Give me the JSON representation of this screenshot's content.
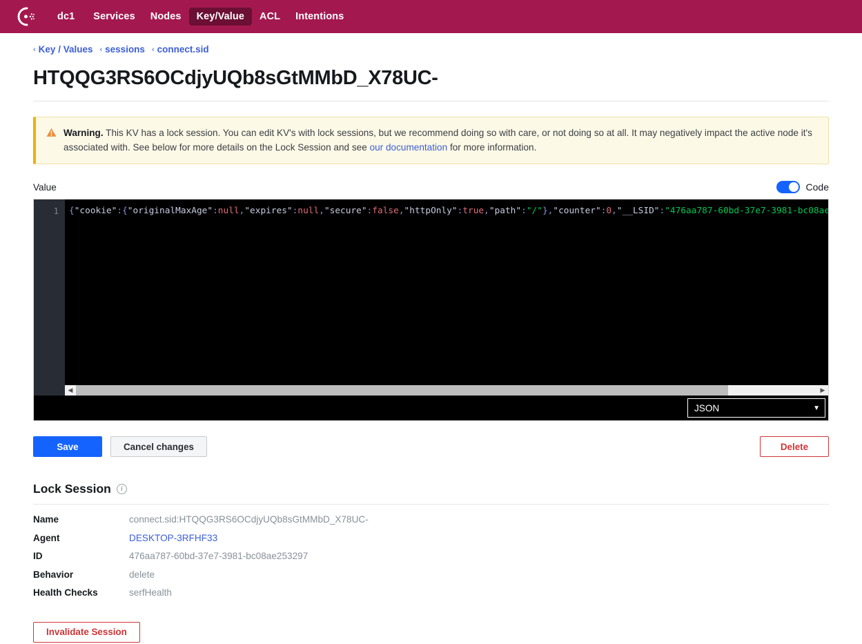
{
  "nav": {
    "logo_icon": "consul-logo-icon",
    "items": [
      {
        "label": "dc1",
        "active": false
      },
      {
        "label": "Services",
        "active": false
      },
      {
        "label": "Nodes",
        "active": false
      },
      {
        "label": "Key/Value",
        "active": true
      },
      {
        "label": "ACL",
        "active": false
      },
      {
        "label": "Intentions",
        "active": false
      }
    ]
  },
  "breadcrumb": {
    "caret": "‹",
    "items": [
      "Key / Values",
      "sessions",
      "connect.sid"
    ]
  },
  "page": {
    "title": "HTQQG3RS6OCdjyUQb8sGtMMbD_X78UC-"
  },
  "warning": {
    "icon": "warning-triangle-icon",
    "bold": "Warning.",
    "text_before_link": " This KV has a lock session. You can edit KV's with lock sessions, but we recommend doing so with care, or not doing so at all. It may negatively impact the active node it's associated with. See below for more details on the Lock Session and see ",
    "link": "our documentation",
    "text_after_link": " for more information."
  },
  "value_section": {
    "label": "Value",
    "code_toggle_label": "Code",
    "code_toggle_on": true,
    "accent_blue": "#1563ff",
    "line_number": "1",
    "language": "JSON",
    "raw_value": "{\"cookie\":{\"originalMaxAge\":null,\"expires\":null,\"secure\":false,\"httpOnly\":true,\"path\":\"/\"},\"counter\":0,\"__LSID\":\"476aa787-60bd-37e7-3981-bc08ae",
    "tokens": [
      {
        "t": "{",
        "c": "punct"
      },
      {
        "t": "\"cookie\"",
        "c": "key"
      },
      {
        "t": ":{",
        "c": "punct"
      },
      {
        "t": "\"originalMaxAge\"",
        "c": "key"
      },
      {
        "t": ":",
        "c": "punct"
      },
      {
        "t": "null",
        "c": "null"
      },
      {
        "t": ",",
        "c": "punct"
      },
      {
        "t": "\"expires\"",
        "c": "key"
      },
      {
        "t": ":",
        "c": "punct"
      },
      {
        "t": "null",
        "c": "null"
      },
      {
        "t": ",",
        "c": "punct"
      },
      {
        "t": "\"secure\"",
        "c": "key"
      },
      {
        "t": ":",
        "c": "punct"
      },
      {
        "t": "false",
        "c": "bool"
      },
      {
        "t": ",",
        "c": "punct"
      },
      {
        "t": "\"httpOnly\"",
        "c": "key"
      },
      {
        "t": ":",
        "c": "punct"
      },
      {
        "t": "true",
        "c": "bool"
      },
      {
        "t": ",",
        "c": "punct"
      },
      {
        "t": "\"path\"",
        "c": "key"
      },
      {
        "t": ":",
        "c": "punct"
      },
      {
        "t": "\"/\"",
        "c": "str"
      },
      {
        "t": "},",
        "c": "punct"
      },
      {
        "t": "\"counter\"",
        "c": "key"
      },
      {
        "t": ":",
        "c": "punct"
      },
      {
        "t": "0",
        "c": "num"
      },
      {
        "t": ",",
        "c": "punct"
      },
      {
        "t": "\"__LSID\"",
        "c": "key"
      },
      {
        "t": ":",
        "c": "punct"
      },
      {
        "t": "\"476aa787-60bd-37e7-3981-bc08ae",
        "c": "str"
      }
    ]
  },
  "actions": {
    "save": "Save",
    "cancel": "Cancel changes",
    "delete": "Delete"
  },
  "lock_session": {
    "title": "Lock Session",
    "info_icon": "info-icon",
    "rows": [
      {
        "key": "Name",
        "value": "connect.sid:HTQQG3RS6OCdjyUQb8sGtMMbD_X78UC-",
        "link": false
      },
      {
        "key": "Agent",
        "value": "DESKTOP-3RFHF33",
        "link": true
      },
      {
        "key": "ID",
        "value": "476aa787-60bd-37e7-3981-bc08ae253297",
        "link": false
      },
      {
        "key": "Behavior",
        "value": "delete",
        "link": false
      },
      {
        "key": "Health Checks",
        "value": "serfHealth",
        "link": false
      }
    ],
    "invalidate_button": "Invalidate Session"
  }
}
